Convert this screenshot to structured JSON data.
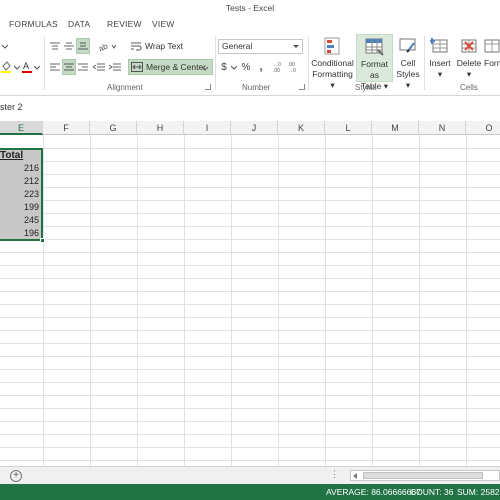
{
  "window": {
    "title": "Tests - Excel"
  },
  "ribbon_tabs": [
    "FORMULAS",
    "DATA",
    "REVIEW",
    "VIEW"
  ],
  "ribbon": {
    "alignment": {
      "wrap_text": "Wrap Text",
      "merge_center": "Merge & Center",
      "label": "Alignment"
    },
    "number": {
      "format_value": "General",
      "currency": "$",
      "percent": "%",
      "comma": ",",
      "label": "Number"
    },
    "styles": {
      "conditional_formatting": [
        "Conditional",
        "Formatting"
      ],
      "format_as_table": [
        "Format as",
        "Table"
      ],
      "cell_styles": [
        "Cell",
        "Styles"
      ],
      "label": "Styles"
    },
    "cells": {
      "insert": "Insert",
      "delete": "Delete",
      "format": "Form",
      "label": "Cells"
    }
  },
  "name_box": {
    "text": "ster 2"
  },
  "columns": [
    "E",
    "F",
    "G",
    "H",
    "I",
    "J",
    "K",
    "L",
    "M",
    "N",
    "O"
  ],
  "selected_column": "E",
  "cells": {
    "header": "Total",
    "values": [
      "216",
      "212",
      "223",
      "199",
      "245",
      "196"
    ]
  },
  "sheetbar": {
    "add_label": "+",
    "dots": "⋮"
  },
  "status": {
    "average": "AVERAGE: 86.06666667",
    "count": "COUNT: 36",
    "sum": "SUM: 2582"
  },
  "colors": {
    "accent": "#217346",
    "selection": "#c8c8c8",
    "active_button": "#c5dbc6"
  }
}
